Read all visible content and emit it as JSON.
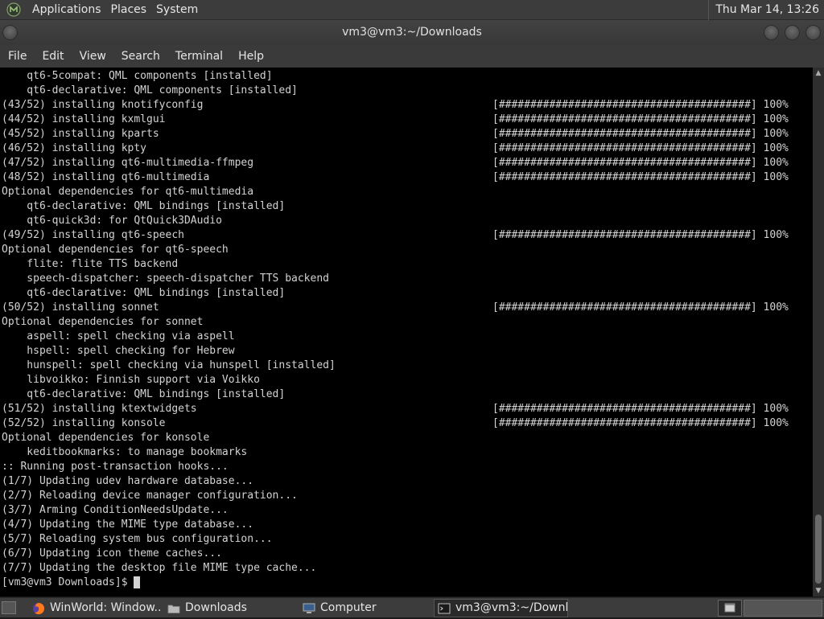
{
  "top_panel": {
    "menus": [
      "Applications",
      "Places",
      "System"
    ],
    "clock": "Thu Mar 14, 13:26"
  },
  "window": {
    "title": "vm3@vm3:~/Downloads",
    "menu": [
      "File",
      "Edit",
      "View",
      "Search",
      "Terminal",
      "Help"
    ]
  },
  "terminal": {
    "lines": [
      {
        "text": "    qt6-5compat: QML components [installed]",
        "progress": ""
      },
      {
        "text": "    qt6-declarative: QML components [installed]",
        "progress": ""
      },
      {
        "text": "(43/52) installing knotifyconfig",
        "progress": "[########################################] 100%"
      },
      {
        "text": "(44/52) installing kxmlgui",
        "progress": "[########################################] 100%"
      },
      {
        "text": "(45/52) installing kparts",
        "progress": "[########################################] 100%"
      },
      {
        "text": "(46/52) installing kpty",
        "progress": "[########################################] 100%"
      },
      {
        "text": "(47/52) installing qt6-multimedia-ffmpeg",
        "progress": "[########################################] 100%"
      },
      {
        "text": "(48/52) installing qt6-multimedia",
        "progress": "[########################################] 100%"
      },
      {
        "text": "Optional dependencies for qt6-multimedia",
        "progress": ""
      },
      {
        "text": "    qt6-declarative: QML bindings [installed]",
        "progress": ""
      },
      {
        "text": "    qt6-quick3d: for QtQuick3DAudio",
        "progress": ""
      },
      {
        "text": "(49/52) installing qt6-speech",
        "progress": "[########################################] 100%"
      },
      {
        "text": "Optional dependencies for qt6-speech",
        "progress": ""
      },
      {
        "text": "    flite: flite TTS backend",
        "progress": ""
      },
      {
        "text": "    speech-dispatcher: speech-dispatcher TTS backend",
        "progress": ""
      },
      {
        "text": "    qt6-declarative: QML bindings [installed]",
        "progress": ""
      },
      {
        "text": "(50/52) installing sonnet",
        "progress": "[########################################] 100%"
      },
      {
        "text": "Optional dependencies for sonnet",
        "progress": ""
      },
      {
        "text": "    aspell: spell checking via aspell",
        "progress": ""
      },
      {
        "text": "    hspell: spell checking for Hebrew",
        "progress": ""
      },
      {
        "text": "    hunspell: spell checking via hunspell [installed]",
        "progress": ""
      },
      {
        "text": "    libvoikko: Finnish support via Voikko",
        "progress": ""
      },
      {
        "text": "    qt6-declarative: QML bindings [installed]",
        "progress": ""
      },
      {
        "text": "(51/52) installing ktextwidgets",
        "progress": "[########################################] 100%"
      },
      {
        "text": "(52/52) installing konsole",
        "progress": "[########################################] 100%"
      },
      {
        "text": "Optional dependencies for konsole",
        "progress": ""
      },
      {
        "text": "    keditbookmarks: to manage bookmarks",
        "progress": ""
      },
      {
        "text": ":: Running post-transaction hooks...",
        "progress": ""
      },
      {
        "text": "(1/7) Updating udev hardware database...",
        "progress": ""
      },
      {
        "text": "(2/7) Reloading device manager configuration...",
        "progress": ""
      },
      {
        "text": "(3/7) Arming ConditionNeedsUpdate...",
        "progress": ""
      },
      {
        "text": "(4/7) Updating the MIME type database...",
        "progress": ""
      },
      {
        "text": "(5/7) Reloading system bus configuration...",
        "progress": ""
      },
      {
        "text": "(6/7) Updating icon theme caches...",
        "progress": ""
      },
      {
        "text": "(7/7) Updating the desktop file MIME type cache...",
        "progress": ""
      },
      {
        "text": "[vm3@vm3 Downloads]$ ",
        "progress": ""
      }
    ]
  },
  "taskbar": {
    "tasks": [
      {
        "label": "WinWorld: Window...",
        "icon": "firefox-icon"
      },
      {
        "label": "Downloads",
        "icon": "folder-icon"
      },
      {
        "label": "Computer",
        "icon": "computer-icon"
      },
      {
        "label": "vm3@vm3:~/Downl...",
        "icon": "terminal-icon"
      }
    ]
  },
  "colors": {
    "panel": "#3c3c3c",
    "terminal_bg": "#000000",
    "terminal_fg": "#d3d3d3"
  }
}
